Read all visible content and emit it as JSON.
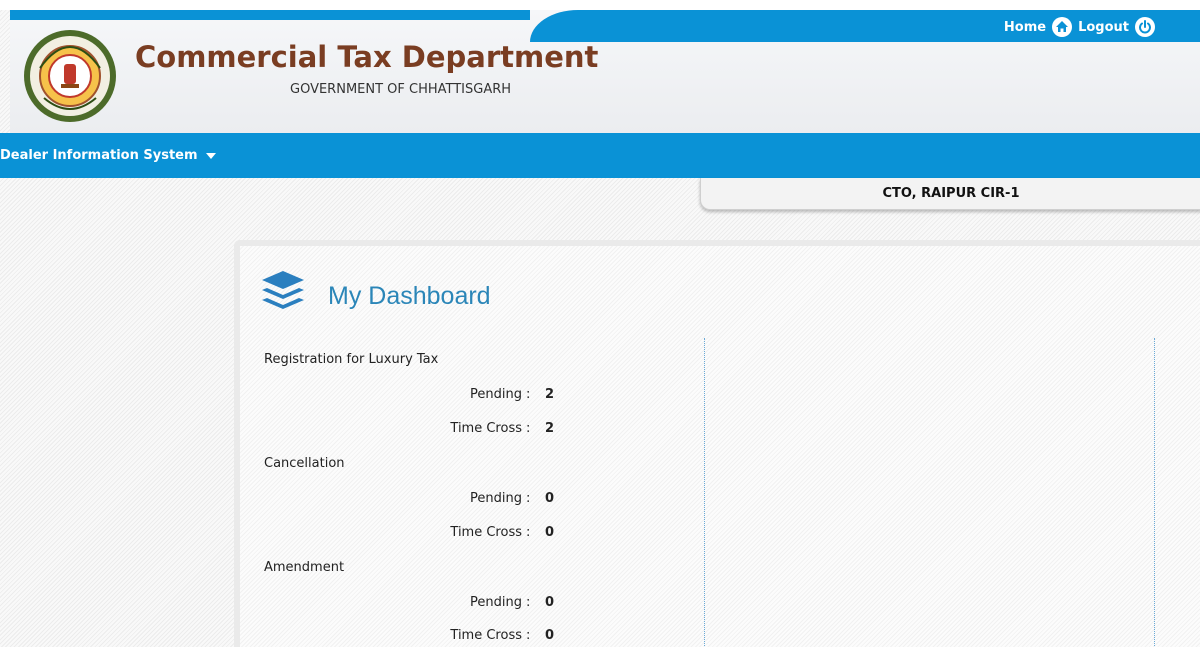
{
  "header": {
    "title": "Commercial Tax Department",
    "subtitle": "GOVERNMENT OF CHHATTISGARH",
    "links": {
      "home": "Home",
      "logout": "Logout"
    }
  },
  "nav": {
    "menu_label": "Dealer Information System"
  },
  "office": {
    "name": "CTO, RAIPUR CIR-1"
  },
  "dashboard": {
    "title": "My Dashboard",
    "sections": [
      {
        "label": "Registration for Luxury Tax",
        "rows": [
          {
            "label": "Pending",
            "value": "2"
          },
          {
            "label": "Time Cross",
            "value": "2"
          }
        ]
      },
      {
        "label": "Cancellation",
        "rows": [
          {
            "label": "Pending",
            "value": "0"
          },
          {
            "label": "Time Cross",
            "value": "0"
          }
        ]
      },
      {
        "label": "Amendment",
        "rows": [
          {
            "label": "Pending",
            "value": "0"
          },
          {
            "label": "Time Cross",
            "value": "0"
          }
        ]
      }
    ]
  },
  "colors": {
    "brand_blue": "#0a92d6",
    "title_brown": "#7a3d22",
    "dashboard_title_blue": "#2b86b8"
  },
  "icons": {
    "logo": "state-emblem-seal",
    "home": "home-icon",
    "logout": "power-icon",
    "dashboard": "layers-icon",
    "menu_caret": "caret-down-icon"
  }
}
